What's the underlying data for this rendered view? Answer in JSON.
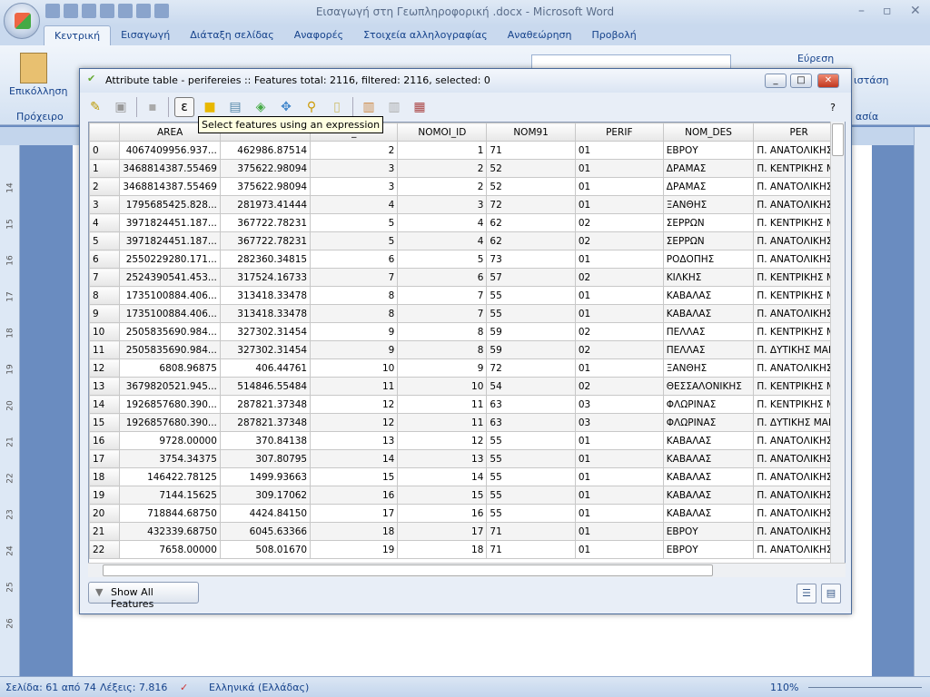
{
  "word": {
    "title": "Εισαγωγή στη Γεωπληροφορική .docx - Microsoft Word",
    "tabs": [
      "Κεντρική",
      "Εισαγωγή",
      "Διάταξη σελίδας",
      "Αναφορές",
      "Στοιχεία αλληλογραφίας",
      "Αναθεώρηση",
      "Προβολή"
    ],
    "paste_label": "Επικόλληση",
    "clipboard_group": "Πρόχειρο",
    "find_label": "Εύρεση",
    "replace_partial": "ιστάση",
    "group_partial": "ασία",
    "ruler_numbers": [
      "14",
      "15",
      "16",
      "17",
      "18",
      "19",
      "20",
      "21",
      "22",
      "23",
      "24",
      "25",
      "26"
    ],
    "status": {
      "page": "Σελίδα: 61 από 74",
      "words": "Λέξεις: 7.816",
      "language": "Ελληνικά (Ελλάδας)",
      "zoom": "110%"
    }
  },
  "dialog": {
    "title": "Attribute table - perifereies :: Features total: 2116, filtered: 2116, selected: 0",
    "tooltip": "Select features using an expression",
    "help": "?",
    "show_all": "Show All Features",
    "columns": [
      "AREA",
      "",
      "_",
      "NOMOI_ID",
      "NOM91",
      "PERIF",
      "NOM_DES",
      "PER"
    ],
    "rows": [
      [
        "0",
        "4067409956.937...",
        "462986.87514",
        "2",
        "1",
        "71",
        "01",
        "ΕΒΡΟΥ",
        "Π. ΑΝΑΤΟΛΙΚΗΣ"
      ],
      [
        "1",
        "3468814387.55469",
        "375622.98094",
        "3",
        "2",
        "52",
        "01",
        "ΔΡΑΜΑΣ",
        "Π. ΚΕΝΤΡΙΚΗΣ Μ"
      ],
      [
        "2",
        "3468814387.55469",
        "375622.98094",
        "3",
        "2",
        "52",
        "01",
        "ΔΡΑΜΑΣ",
        "Π. ΑΝΑΤΟΛΙΚΗΣ"
      ],
      [
        "3",
        "1795685425.828...",
        "281973.41444",
        "4",
        "3",
        "72",
        "01",
        "ΞΑΝΘΗΣ",
        "Π. ΑΝΑΤΟΛΙΚΗΣ"
      ],
      [
        "4",
        "3971824451.187...",
        "367722.78231",
        "5",
        "4",
        "62",
        "02",
        "ΣΕΡΡΩΝ",
        "Π. ΚΕΝΤΡΙΚΗΣ Μ"
      ],
      [
        "5",
        "3971824451.187...",
        "367722.78231",
        "5",
        "4",
        "62",
        "02",
        "ΣΕΡΡΩΝ",
        "Π. ΑΝΑΤΟΛΙΚΗΣ"
      ],
      [
        "6",
        "2550229280.171...",
        "282360.34815",
        "6",
        "5",
        "73",
        "01",
        "ΡΟΔΟΠΗΣ",
        "Π. ΑΝΑΤΟΛΙΚΗΣ"
      ],
      [
        "7",
        "2524390541.453...",
        "317524.16733",
        "7",
        "6",
        "57",
        "02",
        "ΚΙΛΚΗΣ",
        "Π. ΚΕΝΤΡΙΚΗΣ Μ"
      ],
      [
        "8",
        "1735100884.406...",
        "313418.33478",
        "8",
        "7",
        "55",
        "01",
        "ΚΑΒΑΛΑΣ",
        "Π. ΚΕΝΤΡΙΚΗΣ Μ"
      ],
      [
        "9",
        "1735100884.406...",
        "313418.33478",
        "8",
        "7",
        "55",
        "01",
        "ΚΑΒΑΛΑΣ",
        "Π. ΑΝΑΤΟΛΙΚΗΣ"
      ],
      [
        "10",
        "2505835690.984...",
        "327302.31454",
        "9",
        "8",
        "59",
        "02",
        "ΠΕΛΛΑΣ",
        "Π. ΚΕΝΤΡΙΚΗΣ Μ"
      ],
      [
        "11",
        "2505835690.984...",
        "327302.31454",
        "9",
        "8",
        "59",
        "02",
        "ΠΕΛΛΑΣ",
        "Π. ΔΥΤΙΚΗΣ ΜΑΚ"
      ],
      [
        "12",
        "6808.96875",
        "406.44761",
        "10",
        "9",
        "72",
        "01",
        "ΞΑΝΘΗΣ",
        "Π. ΑΝΑΤΟΛΙΚΗΣ"
      ],
      [
        "13",
        "3679820521.945...",
        "514846.55484",
        "11",
        "10",
        "54",
        "02",
        "ΘΕΣΣΑΛΟΝΙΚΗΣ",
        "Π. ΚΕΝΤΡΙΚΗΣ Μ"
      ],
      [
        "14",
        "1926857680.390...",
        "287821.37348",
        "12",
        "11",
        "63",
        "03",
        "ΦΛΩΡΙΝΑΣ",
        "Π. ΚΕΝΤΡΙΚΗΣ Μ"
      ],
      [
        "15",
        "1926857680.390...",
        "287821.37348",
        "12",
        "11",
        "63",
        "03",
        "ΦΛΩΡΙΝΑΣ",
        "Π. ΔΥΤΙΚΗΣ ΜΑΚ"
      ],
      [
        "16",
        "9728.00000",
        "370.84138",
        "13",
        "12",
        "55",
        "01",
        "ΚΑΒΑΛΑΣ",
        "Π. ΑΝΑΤΟΛΙΚΗΣ"
      ],
      [
        "17",
        "3754.34375",
        "307.80795",
        "14",
        "13",
        "55",
        "01",
        "ΚΑΒΑΛΑΣ",
        "Π. ΑΝΑΤΟΛΙΚΗΣ"
      ],
      [
        "18",
        "146422.78125",
        "1499.93663",
        "15",
        "14",
        "55",
        "01",
        "ΚΑΒΑΛΑΣ",
        "Π. ΑΝΑΤΟΛΙΚΗΣ"
      ],
      [
        "19",
        "7144.15625",
        "309.17062",
        "16",
        "15",
        "55",
        "01",
        "ΚΑΒΑΛΑΣ",
        "Π. ΑΝΑΤΟΛΙΚΗΣ"
      ],
      [
        "20",
        "718844.68750",
        "4424.84150",
        "17",
        "16",
        "55",
        "01",
        "ΚΑΒΑΛΑΣ",
        "Π. ΑΝΑΤΟΛΙΚΗΣ"
      ],
      [
        "21",
        "432339.68750",
        "6045.63366",
        "18",
        "17",
        "71",
        "01",
        "ΕΒΡΟΥ",
        "Π. ΑΝΑΤΟΛΙΚΗΣ"
      ],
      [
        "22",
        "7658.00000",
        "508.01670",
        "19",
        "18",
        "71",
        "01",
        "ΕΒΡΟΥ",
        "Π. ΑΝΑΤΟΛΙΚΗΣ"
      ]
    ]
  }
}
